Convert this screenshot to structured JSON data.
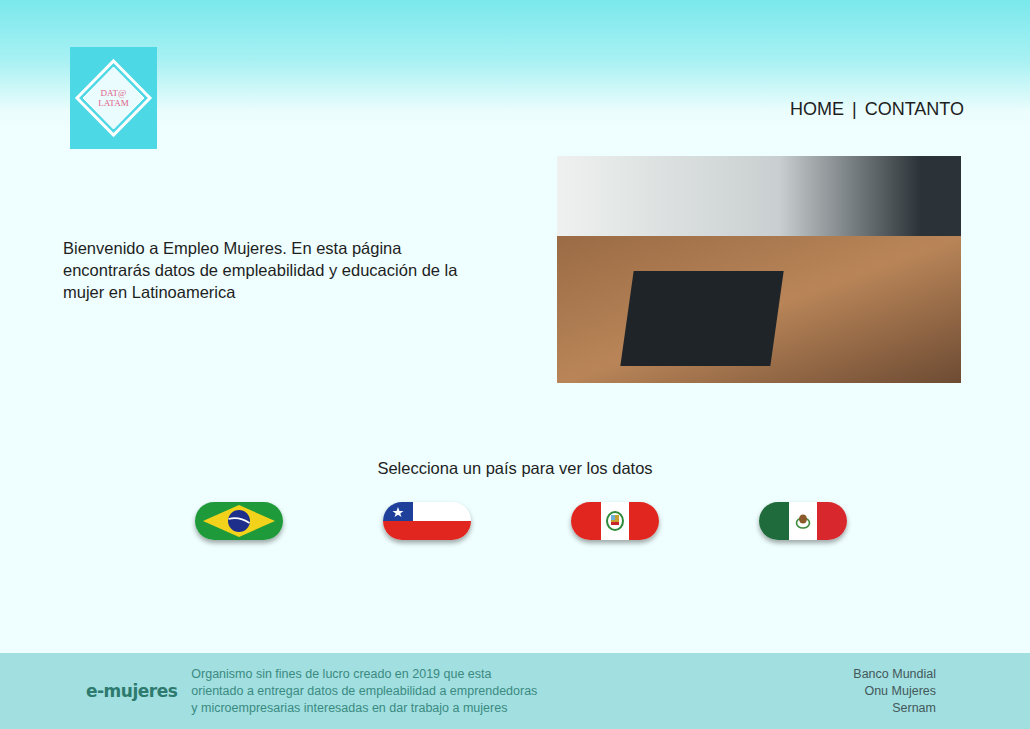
{
  "header": {
    "logo": {
      "lines": [
        "DAT@",
        "LATAM"
      ]
    },
    "nav": {
      "items": [
        "HOME",
        "CONTANTO"
      ],
      "separator": "|"
    }
  },
  "intro": {
    "lines": [
      "Bienvenido a  Empleo Mujeres. En esta página",
      "encontrarás datos de empleabilidad y educación de la",
      "mujer en Latinoamerica"
    ]
  },
  "countries": {
    "prompt": "Selecciona un país para ver los datos",
    "items": [
      {
        "kind": "brazil"
      },
      {
        "kind": "chile"
      },
      {
        "kind": "peru"
      },
      {
        "kind": "mexico"
      }
    ]
  },
  "footer": {
    "brand": "e-mujeres",
    "description": [
      "Organismo sin fines de lucro creado en 2019 que esta",
      "orientado a entregar datos de empleabilidad a emprendedoras",
      "y microempresarias interesadas en dar trabajo a mujeres"
    ],
    "partners": [
      "Banco Mundial",
      "Onu Mujeres",
      "Sernam"
    ]
  }
}
